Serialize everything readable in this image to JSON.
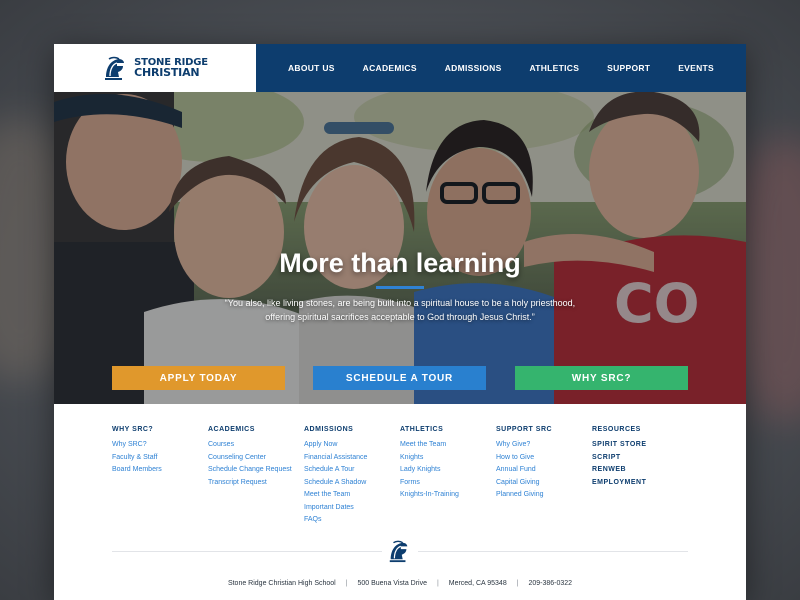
{
  "header": {
    "logo_line1": "STONE RIDGE",
    "logo_line2": "CHRISTIAN",
    "nav": [
      "ABOUT US",
      "ACADEMICS",
      "ADMISSIONS",
      "ATHLETICS",
      "SUPPORT",
      "EVENTS"
    ]
  },
  "hero": {
    "title": "More than learning",
    "quote": "“You also, like living stones, are being built into a spiritual house to be a holy priesthood, offering spiritual sacrifices acceptable to God through Jesus Christ.”",
    "buttons": {
      "apply": "APPLY TODAY",
      "tour": "SCHEDULE A TOUR",
      "why": "WHY SRC?"
    }
  },
  "footer": {
    "columns": [
      {
        "title": "WHY SRC?",
        "links": [
          "Why SRC?",
          "Faculty & Staff",
          "Board Members"
        ]
      },
      {
        "title": "ACADEMICS",
        "links": [
          "Courses",
          "Counseling Center",
          "Schedule Change Request",
          "Transcript Request"
        ]
      },
      {
        "title": "ADMISSIONS",
        "links": [
          "Apply Now",
          "Financial Assistance",
          "Schedule A Tour",
          "Schedule A Shadow",
          "Meet the Team",
          "Important Dates",
          "FAQs"
        ]
      },
      {
        "title": "ATHLETICS",
        "links": [
          "Meet the Team",
          "Knights",
          "Lady Knights",
          "Forms",
          "Knights-In-Training"
        ]
      },
      {
        "title": "SUPPORT SRC",
        "links": [
          "Why Give?",
          "How to Give",
          "Annual Fund",
          "Capital Giving",
          "Planned Giving"
        ]
      },
      {
        "title": "RESOURCES",
        "links": [
          "SPIRIT STORE",
          "SCRIPT",
          "RENWEB",
          "EMPLOYMENT"
        ]
      }
    ],
    "address": {
      "school": "Stone Ridge Christian High School",
      "street": "500 Buena Vista Drive",
      "city": "Merced, CA 95348",
      "phone": "209-386-0322",
      "separator": "|"
    }
  },
  "colors": {
    "brand_navy": "#0d3d6e",
    "accent_blue": "#2980cf",
    "apply_orange": "#e0982c",
    "why_green": "#35b46e"
  },
  "icons": [
    "knight-helmet-icon"
  ]
}
